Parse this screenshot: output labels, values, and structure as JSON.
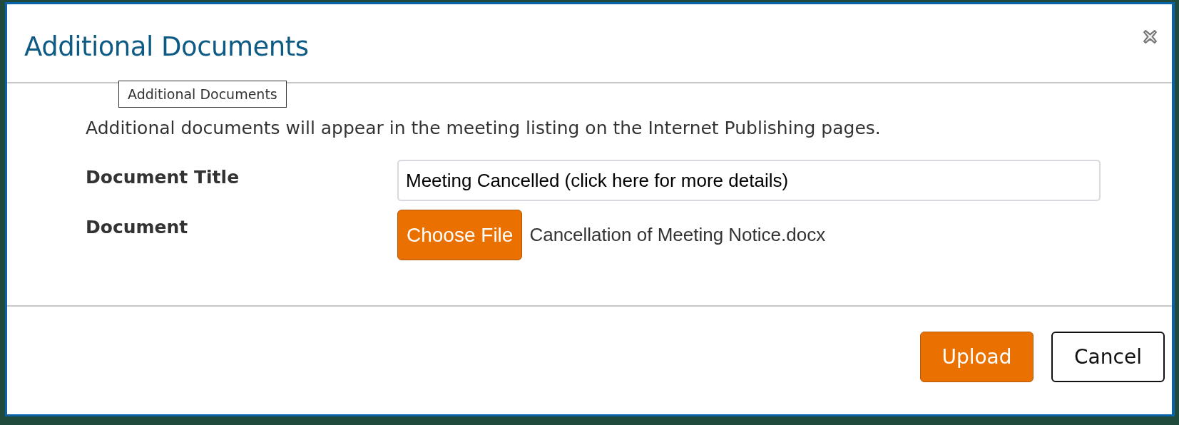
{
  "dialog": {
    "title": "Additional Documents",
    "tooltip": "Additional Documents",
    "description": "Additional documents will appear in the meeting listing on the Internet Publishing pages.",
    "fields": [
      {
        "kind": "text",
        "label": "Document Title",
        "value": "Meeting Cancelled (click here for more details)"
      },
      {
        "kind": "file",
        "label": "Document",
        "button": "Choose File",
        "file_name": "Cancellation of Meeting Notice.docx"
      }
    ],
    "buttons": [
      {
        "kind": "primary",
        "label": "Upload"
      },
      {
        "kind": "secondary",
        "label": "Cancel"
      }
    ]
  }
}
